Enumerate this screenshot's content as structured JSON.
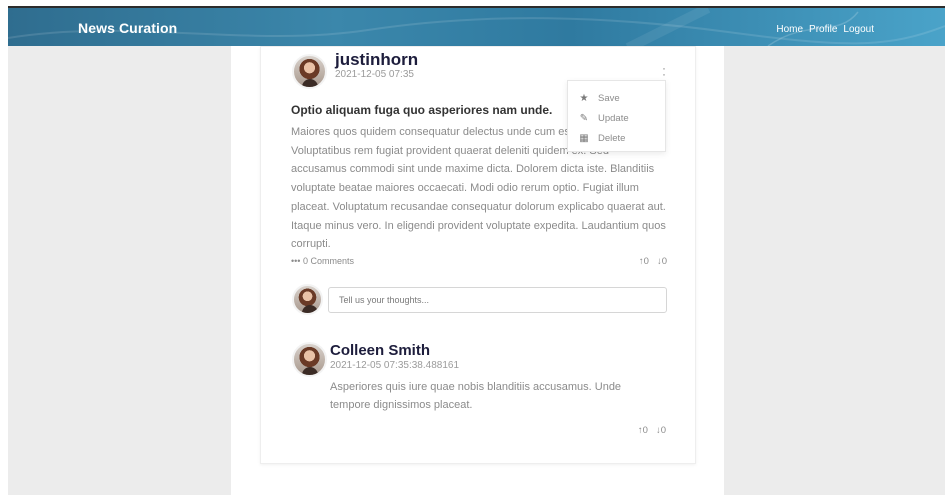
{
  "navbar": {
    "brand": "News Curation",
    "links": [
      "Home",
      "Profile",
      "Logout"
    ]
  },
  "post": {
    "author": "justinhorn",
    "timestamp": "2021-12-05 07:35",
    "title": "Optio aliquam fuga quo asperiores nam unde.",
    "body": "Maiores quos quidem consequatur delectus unde cum esse sapiente tenetur. Voluptatibus rem fugiat provident quaerat deleniti quidem ex. Sed accusamus commodi sint unde maxime dicta. Dolorem dicta iste. Blanditiis voluptate beatae maiores occaecati. Modi odio rerum optio. Fugiat illum placeat. Voluptatum recusandae consequatur dolorum explicabo quaerat aut. Itaque minus vero. In eligendi provident voluptate expedita. Laudantium quos corrupti.",
    "comments_label": "0 Comments",
    "upvotes": "0",
    "downvotes": "0",
    "menu": {
      "save": "Save",
      "update": "Update",
      "delete": "Delete"
    }
  },
  "comment_form": {
    "placeholder": "Tell us your thoughts..."
  },
  "comment": {
    "author": "Colleen Smith",
    "timestamp": "2021-12-05 07:35:38.488161",
    "body": "Asperiores quis iure quae nobis blanditiis accusamus. Unde tempore dignissimos placeat.",
    "upvotes": "0",
    "downvotes": "0"
  },
  "icons": {
    "menu": "kebab-icon",
    "save": "star-icon",
    "update": "edit-icon",
    "delete": "trash-icon",
    "comments": "ellipsis-icon",
    "upvote": "arrow-up-icon",
    "downvote": "arrow-down-icon"
  },
  "colors": {
    "navbar": "#3b87ab",
    "author": "#1d1d3c"
  }
}
